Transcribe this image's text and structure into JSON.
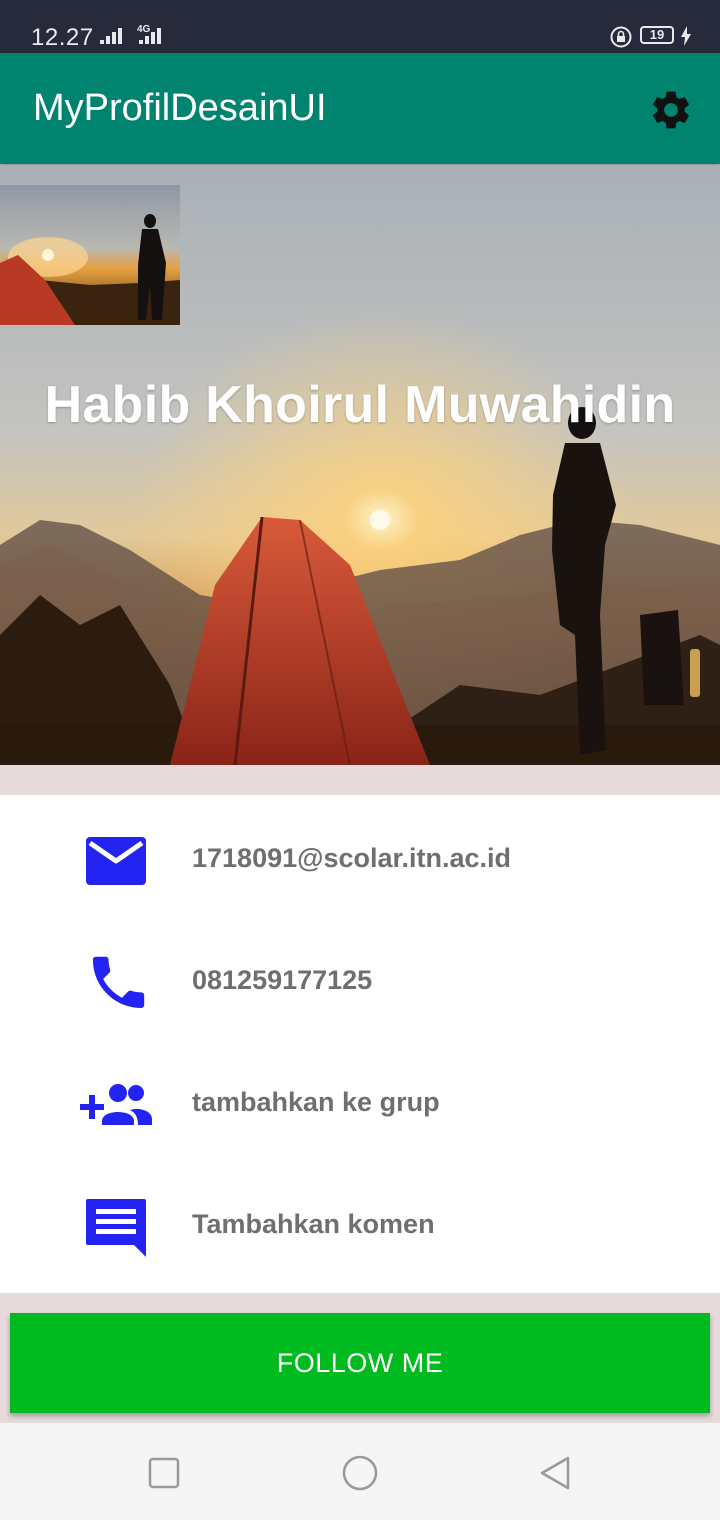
{
  "status_bar": {
    "time": "12.27",
    "network": "4G",
    "battery": "19"
  },
  "app_bar": {
    "title": "MyProfilDesainUI",
    "settings_icon": "gear-icon"
  },
  "profile": {
    "name": "Habib Khoirul Muwahidin"
  },
  "contact": [
    {
      "icon": "mail-icon",
      "text": "1718091@scolar.itn.ac.id"
    },
    {
      "icon": "phone-icon",
      "text": "081259177125"
    },
    {
      "icon": "group-add-icon",
      "text": "tambahkan ke grup"
    },
    {
      "icon": "comment-icon",
      "text": "Tambahkan komen"
    }
  ],
  "follow_button": {
    "label": "FOLLOW ME"
  },
  "colors": {
    "app_bar": "#00846f",
    "accent_icons": "#2424f2",
    "follow_button": "#00bb1f",
    "status_bar": "#272a3a"
  }
}
